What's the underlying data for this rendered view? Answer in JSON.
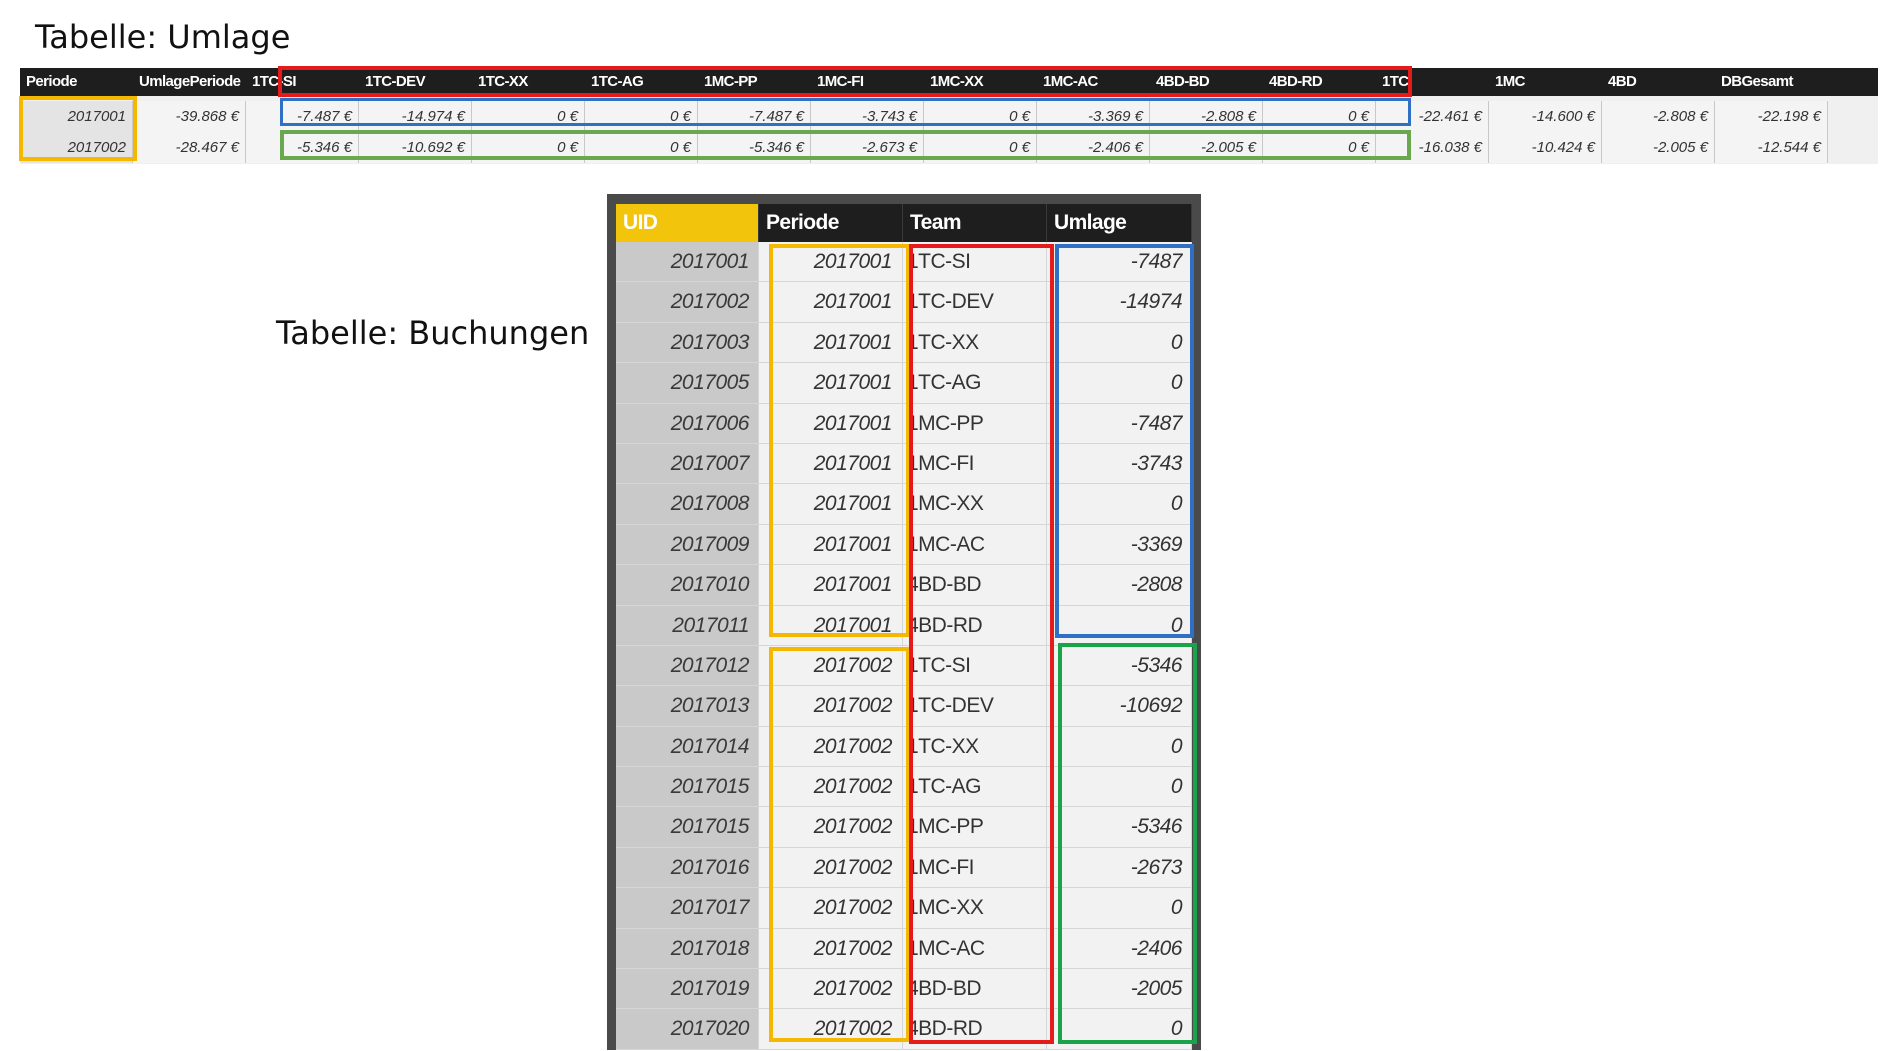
{
  "titles": {
    "umlage": "Tabelle: Umlage",
    "buchungen": "Tabelle: Buchungen"
  },
  "umlage": {
    "headers": [
      "Periode",
      "UmlagePeriode",
      "1TC-SI",
      "1TC-DEV",
      "1TC-XX",
      "1TC-AG",
      "1MC-PP",
      "1MC-FI",
      "1MC-XX",
      "1MC-AC",
      "4BD-BD",
      "4BD-RD",
      "1TC",
      "1MC",
      "4BD",
      "DBGesamt"
    ],
    "rows": [
      [
        "2017001",
        "-39.868 €",
        "-7.487 €",
        "-14.974 €",
        "0 €",
        "0 €",
        "-7.487 €",
        "-3.743 €",
        "0 €",
        "-3.369 €",
        "-2.808 €",
        "0 €",
        "-22.461 €",
        "-14.600 €",
        "-2.808 €",
        "-22.198 €"
      ],
      [
        "2017002",
        "-28.467 €",
        "-5.346 €",
        "-10.692 €",
        "0 €",
        "0 €",
        "-5.346 €",
        "-2.673 €",
        "0 €",
        "-2.406 €",
        "-2.005 €",
        "0 €",
        "-16.038 €",
        "-10.424 €",
        "-2.005 €",
        "-12.544 €"
      ]
    ]
  },
  "buchungen": {
    "headers": [
      "UID",
      "Periode",
      "Team",
      "Umlage"
    ],
    "rows": [
      [
        "2017001",
        "2017001",
        "1TC-SI",
        "-7487"
      ],
      [
        "2017002",
        "2017001",
        "1TC-DEV",
        "-14974"
      ],
      [
        "2017003",
        "2017001",
        "1TC-XX",
        "0"
      ],
      [
        "2017005",
        "2017001",
        "1TC-AG",
        "0"
      ],
      [
        "2017006",
        "2017001",
        "1MC-PP",
        "-7487"
      ],
      [
        "2017007",
        "2017001",
        "1MC-FI",
        "-3743"
      ],
      [
        "2017008",
        "2017001",
        "1MC-XX",
        "0"
      ],
      [
        "2017009",
        "2017001",
        "1MC-AC",
        "-3369"
      ],
      [
        "2017010",
        "2017001",
        "4BD-BD",
        "-2808"
      ],
      [
        "2017011",
        "2017001",
        "4BD-RD",
        "0"
      ],
      [
        "2017012",
        "2017002",
        "1TC-SI",
        "-5346"
      ],
      [
        "2017013",
        "2017002",
        "1TC-DEV",
        "-10692"
      ],
      [
        "2017014",
        "2017002",
        "1TC-XX",
        "0"
      ],
      [
        "2017015",
        "2017002",
        "1TC-AG",
        "0"
      ],
      [
        "2017015",
        "2017002",
        "1MC-PP",
        "-5346"
      ],
      [
        "2017016",
        "2017002",
        "1MC-FI",
        "-2673"
      ],
      [
        "2017017",
        "2017002",
        "1MC-XX",
        "0"
      ],
      [
        "2017018",
        "2017002",
        "1MC-AC",
        "-2406"
      ],
      [
        "2017019",
        "2017002",
        "4BD-BD",
        "-2005"
      ],
      [
        "2017020",
        "2017002",
        "4BD-RD",
        "0"
      ]
    ]
  },
  "colors": {
    "period_box": "#f5b800",
    "team_box": "#e41b1b",
    "period1_values_box": "#2f6fc4",
    "period2_values_box": "#2ea84a",
    "header_bg": "#1e1e1e",
    "uid_header_bg": "#f2c40c"
  }
}
